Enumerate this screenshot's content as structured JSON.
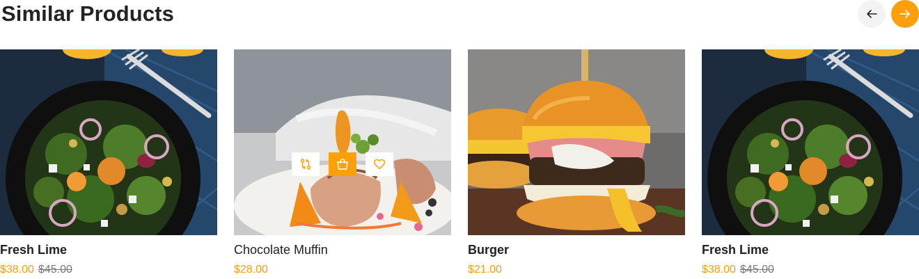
{
  "section": {
    "title": "Similar Products",
    "prev_icon": "arrow-left-icon",
    "next_icon": "arrow-right-icon",
    "accent_color": "#ff9f0a"
  },
  "products": [
    {
      "name": "Fresh Lime",
      "price": "$38.00",
      "old_price": "$45.00",
      "image": "salad-bowl"
    },
    {
      "name": "Chocolate Muffin",
      "price": "$28.00",
      "old_price": "",
      "image": "salmon-plate",
      "actions": [
        {
          "icon": "compare-icon"
        },
        {
          "icon": "shopping-bag-icon"
        },
        {
          "icon": "heart-icon"
        }
      ]
    },
    {
      "name": "Burger",
      "price": "$21.00",
      "old_price": "",
      "image": "burger"
    },
    {
      "name": "Fresh Lime",
      "price": "$38.00",
      "old_price": "$45.00",
      "image": "salad-bowl"
    }
  ]
}
